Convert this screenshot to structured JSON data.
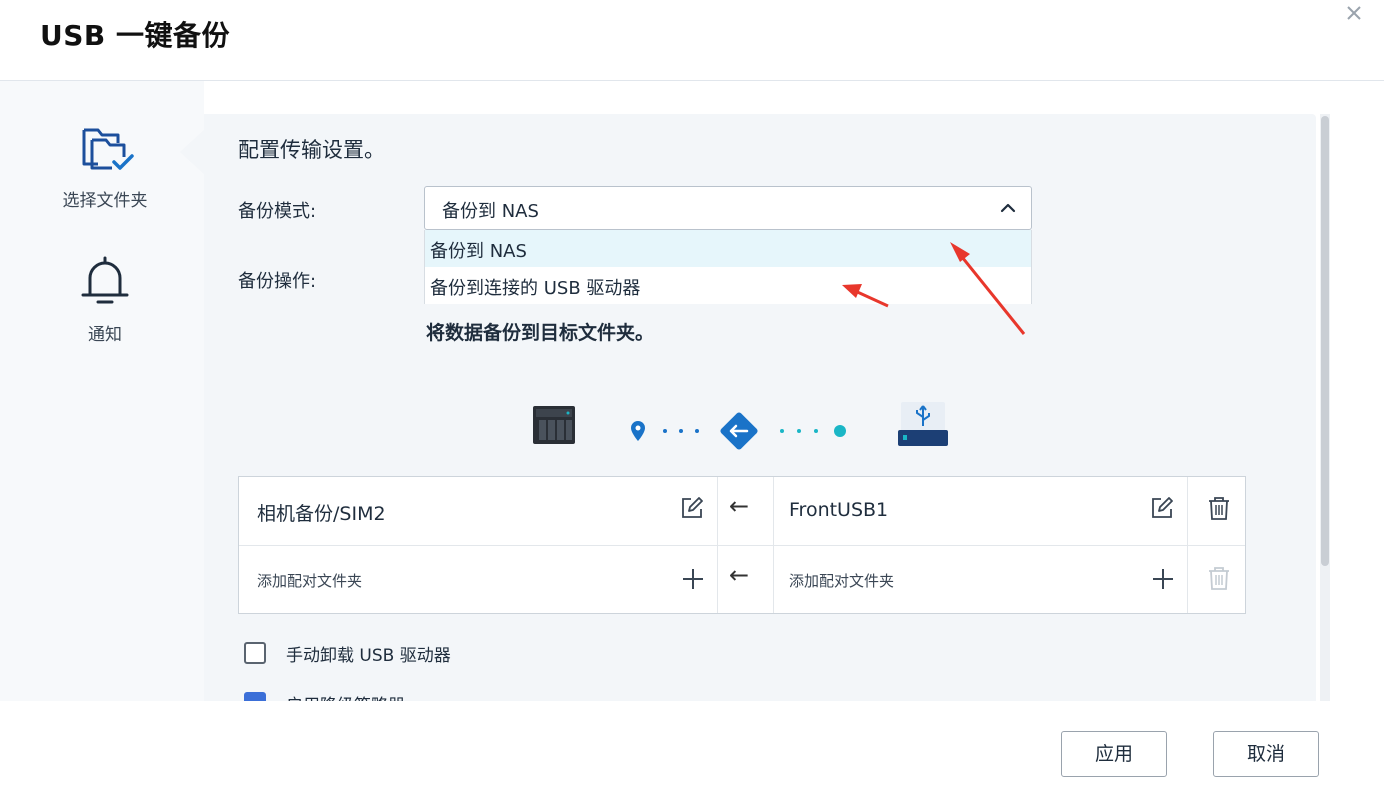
{
  "window": {
    "title": "USB 一键备份"
  },
  "sidebar": {
    "items": [
      {
        "label": "选择文件夹",
        "icon": "folder-check-icon"
      },
      {
        "label": "通知",
        "icon": "bell-icon"
      }
    ]
  },
  "main": {
    "heading": "配置传输设置。",
    "backup_mode": {
      "label": "备份模式:",
      "value": "备份到 NAS",
      "options": [
        "备份到 NAS",
        "备份到连接的 USB 驱动器"
      ]
    },
    "backup_operation": {
      "label": "备份操作:",
      "description": "将数据备份到目标文件夹。"
    },
    "pairs": [
      {
        "source": "相机备份/SIM2",
        "direction": "←",
        "target": "FrontUSB1"
      },
      {
        "source": "添加配对文件夹",
        "direction": "←",
        "target": "添加配对文件夹"
      }
    ],
    "options": [
      {
        "label": "手动卸载 USB 驱动器",
        "checked": false
      },
      {
        "label": "启用降级策略器",
        "checked": true
      }
    ]
  },
  "footer": {
    "apply_label": "应用",
    "cancel_label": "取消"
  },
  "colors": {
    "accent": "#1a73c8",
    "teal": "#1ab6c6",
    "annotation": "#e8372c"
  }
}
